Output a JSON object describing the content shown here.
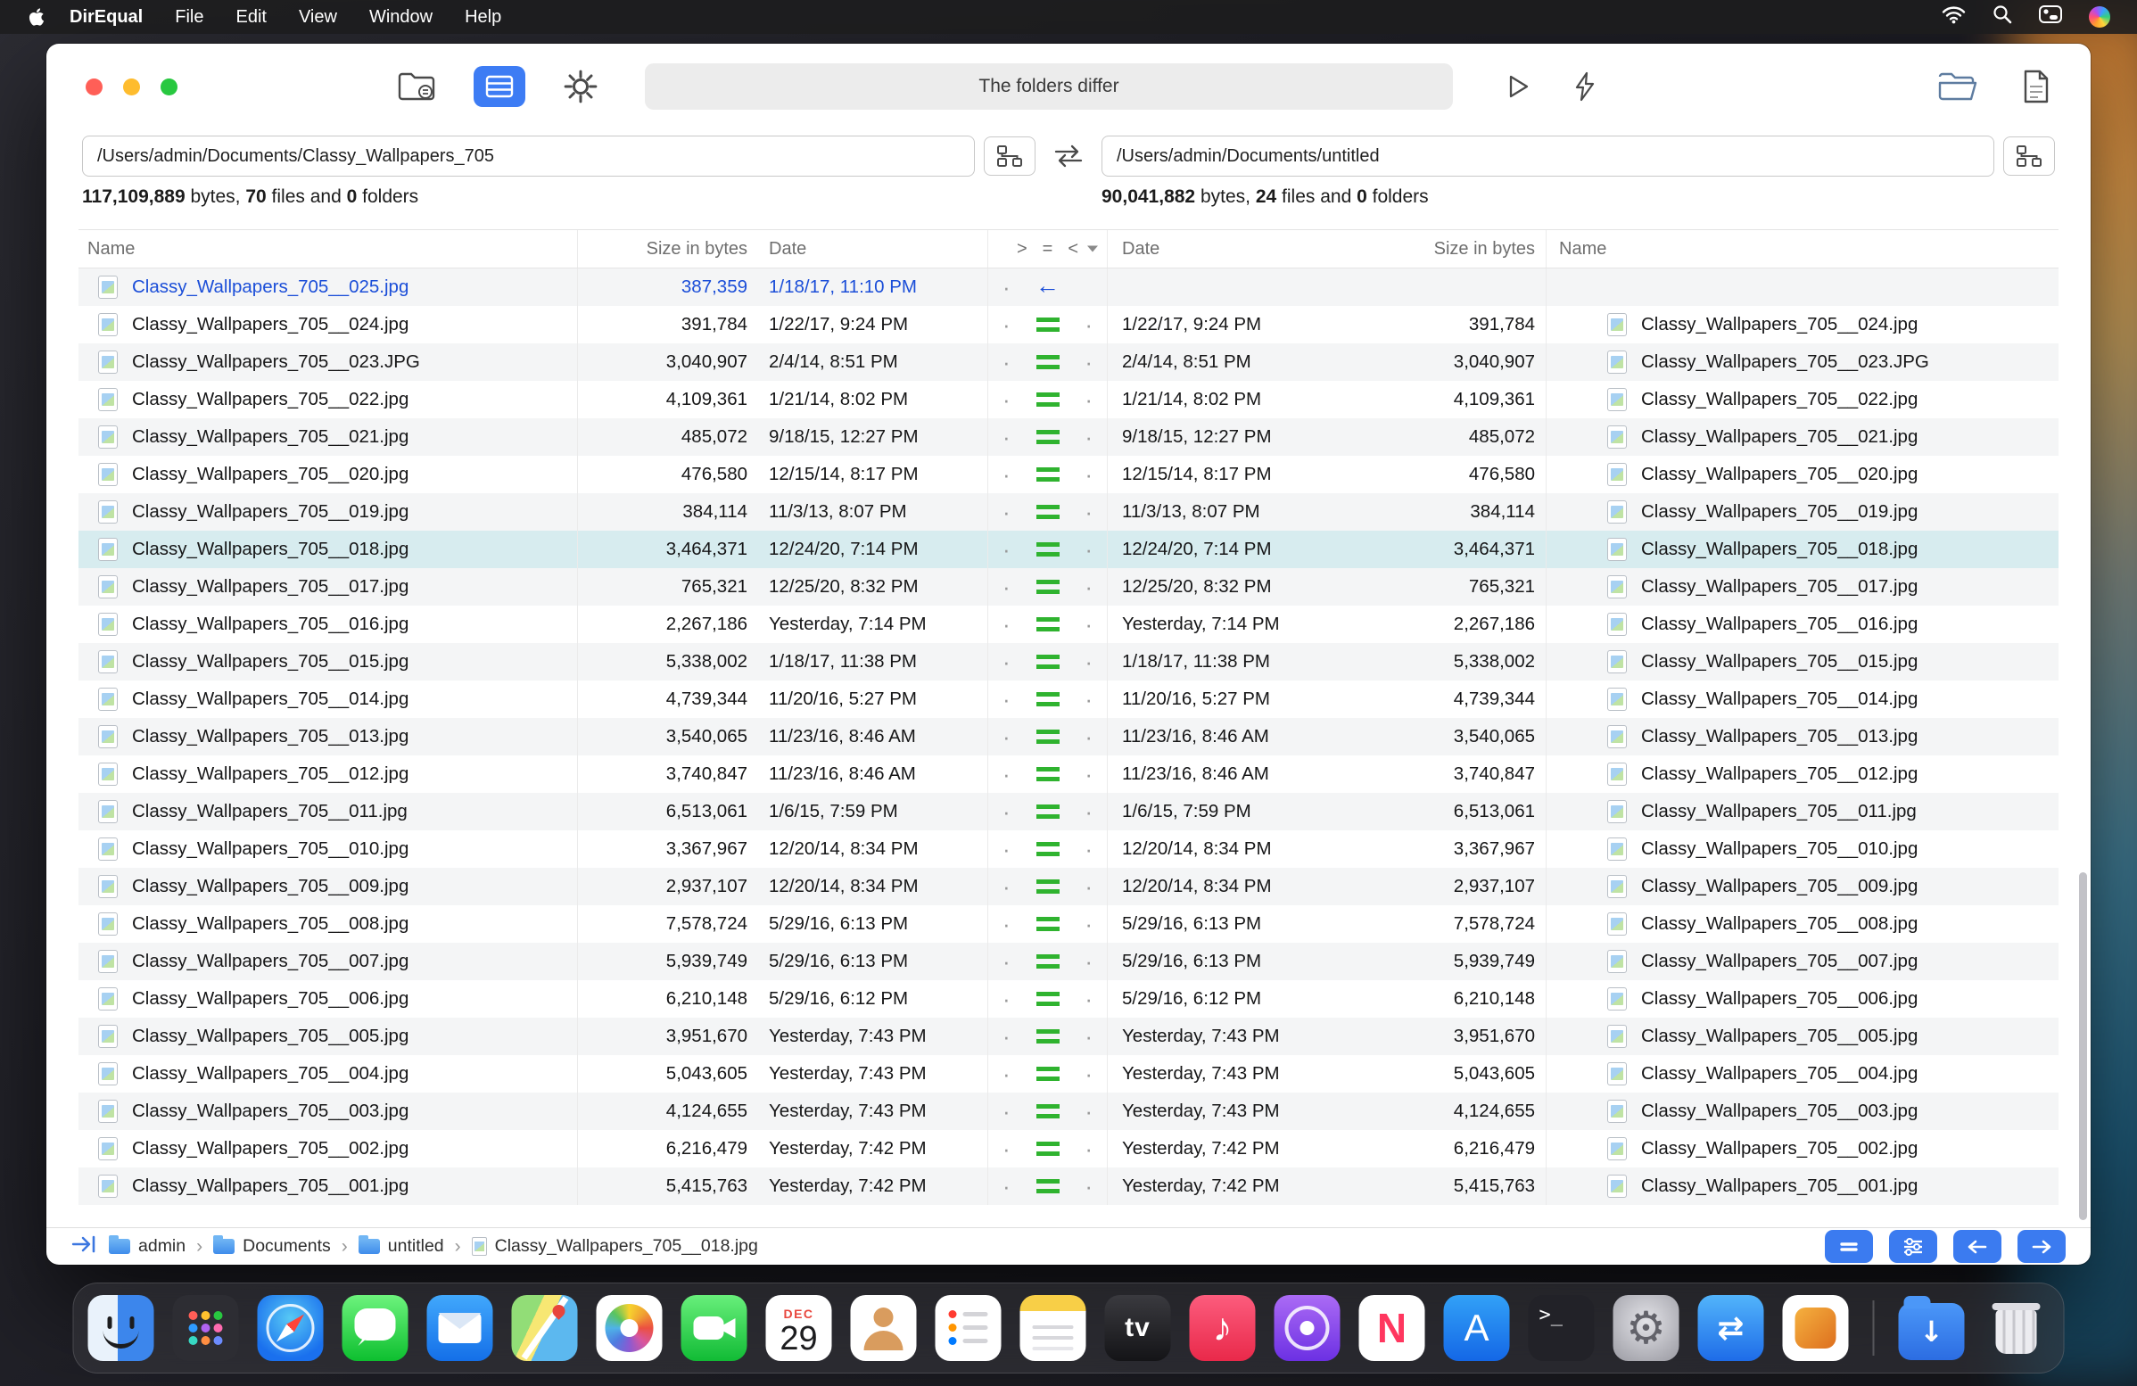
{
  "menu_bar": {
    "app_name": "DirEqual",
    "items": [
      "File",
      "Edit",
      "View",
      "Window",
      "Help"
    ]
  },
  "toolbar": {
    "status_title": "The folders differ"
  },
  "compare": {
    "left": {
      "path": "/Users/admin/Documents/Classy_Wallpapers_705",
      "bytes": "117,109,889",
      "files": "70",
      "folders": "0"
    },
    "right": {
      "path": "/Users/admin/Documents/untitled",
      "bytes": "90,041,882",
      "files": "24",
      "folders": "0"
    },
    "summary_words": {
      "bytes": "bytes,",
      "files": "files and",
      "folders": "folders"
    }
  },
  "table": {
    "headers": {
      "name_left": "Name",
      "size_left": "Size in bytes",
      "date_left": "Date",
      "cmp_gt": ">",
      "cmp_eq": "=",
      "cmp_lt": "<",
      "date_right": "Date",
      "size_right": "Size in bytes",
      "name_right": "Name"
    },
    "rows": [
      {
        "name": "Classy_Wallpapers_705__025.jpg",
        "size": "387,359",
        "date": "1/18/17, 11:10 PM",
        "status": "left-only"
      },
      {
        "name": "Classy_Wallpapers_705__024.jpg",
        "size": "391,784",
        "date": "1/22/17, 9:24 PM",
        "status": "equal"
      },
      {
        "name": "Classy_Wallpapers_705__023.JPG",
        "size": "3,040,907",
        "date": "2/4/14, 8:51 PM",
        "status": "equal"
      },
      {
        "name": "Classy_Wallpapers_705__022.jpg",
        "size": "4,109,361",
        "date": "1/21/14, 8:02 PM",
        "status": "equal"
      },
      {
        "name": "Classy_Wallpapers_705__021.jpg",
        "size": "485,072",
        "date": "9/18/15, 12:27 PM",
        "status": "equal"
      },
      {
        "name": "Classy_Wallpapers_705__020.jpg",
        "size": "476,580",
        "date": "12/15/14, 8:17 PM",
        "status": "equal"
      },
      {
        "name": "Classy_Wallpapers_705__019.jpg",
        "size": "384,114",
        "date": "11/3/13, 8:07 PM",
        "status": "equal"
      },
      {
        "name": "Classy_Wallpapers_705__018.jpg",
        "size": "3,464,371",
        "date": "12/24/20, 7:14 PM",
        "status": "equal",
        "selected": true
      },
      {
        "name": "Classy_Wallpapers_705__017.jpg",
        "size": "765,321",
        "date": "12/25/20, 8:32 PM",
        "status": "equal"
      },
      {
        "name": "Classy_Wallpapers_705__016.jpg",
        "size": "2,267,186",
        "date": "Yesterday, 7:14 PM",
        "status": "equal"
      },
      {
        "name": "Classy_Wallpapers_705__015.jpg",
        "size": "5,338,002",
        "date": "1/18/17, 11:38 PM",
        "status": "equal"
      },
      {
        "name": "Classy_Wallpapers_705__014.jpg",
        "size": "4,739,344",
        "date": "11/20/16, 5:27 PM",
        "status": "equal"
      },
      {
        "name": "Classy_Wallpapers_705__013.jpg",
        "size": "3,540,065",
        "date": "11/23/16, 8:46 AM",
        "status": "equal"
      },
      {
        "name": "Classy_Wallpapers_705__012.jpg",
        "size": "3,740,847",
        "date": "11/23/16, 8:46 AM",
        "status": "equal"
      },
      {
        "name": "Classy_Wallpapers_705__011.jpg",
        "size": "6,513,061",
        "date": "1/6/15, 7:59 PM",
        "status": "equal"
      },
      {
        "name": "Classy_Wallpapers_705__010.jpg",
        "size": "3,367,967",
        "date": "12/20/14, 8:34 PM",
        "status": "equal"
      },
      {
        "name": "Classy_Wallpapers_705__009.jpg",
        "size": "2,937,107",
        "date": "12/20/14, 8:34 PM",
        "status": "equal"
      },
      {
        "name": "Classy_Wallpapers_705__008.jpg",
        "size": "7,578,724",
        "date": "5/29/16, 6:13 PM",
        "status": "equal"
      },
      {
        "name": "Classy_Wallpapers_705__007.jpg",
        "size": "5,939,749",
        "date": "5/29/16, 6:13 PM",
        "status": "equal"
      },
      {
        "name": "Classy_Wallpapers_705__006.jpg",
        "size": "6,210,148",
        "date": "5/29/16, 6:12 PM",
        "status": "equal"
      },
      {
        "name": "Classy_Wallpapers_705__005.jpg",
        "size": "3,951,670",
        "date": "Yesterday, 7:43 PM",
        "status": "equal"
      },
      {
        "name": "Classy_Wallpapers_705__004.jpg",
        "size": "5,043,605",
        "date": "Yesterday, 7:43 PM",
        "status": "equal"
      },
      {
        "name": "Classy_Wallpapers_705__003.jpg",
        "size": "4,124,655",
        "date": "Yesterday, 7:43 PM",
        "status": "equal"
      },
      {
        "name": "Classy_Wallpapers_705__002.jpg",
        "size": "6,216,479",
        "date": "Yesterday, 7:42 PM",
        "status": "equal"
      },
      {
        "name": "Classy_Wallpapers_705__001.jpg",
        "size": "5,415,763",
        "date": "Yesterday, 7:42 PM",
        "status": "equal"
      }
    ]
  },
  "status_bar": {
    "separator": "›",
    "breadcrumb": [
      {
        "icon": "folder",
        "label": "admin"
      },
      {
        "icon": "folder",
        "label": "Documents"
      },
      {
        "icon": "folder",
        "label": "untitled"
      },
      {
        "icon": "file",
        "label": "Classy_Wallpapers_705__018.jpg"
      }
    ]
  },
  "dock": {
    "calendar": {
      "month": "DEC",
      "day": "29"
    },
    "items": [
      "finder",
      "launchpad",
      "safari",
      "messages",
      "mail",
      "maps",
      "photos",
      "facetime",
      "calendar",
      "contacts",
      "reminders",
      "notes",
      "appletv",
      "music",
      "podcasts",
      "news",
      "appstore",
      "terminal",
      "settings",
      "direqual",
      "orange-app",
      "divider",
      "downloads",
      "trash"
    ]
  },
  "colors": {
    "accent": "#3b7bf0",
    "equal_green": "#2fb32f",
    "left_only_blue": "#1b4ed8",
    "selected_row": "#d7ecef"
  }
}
